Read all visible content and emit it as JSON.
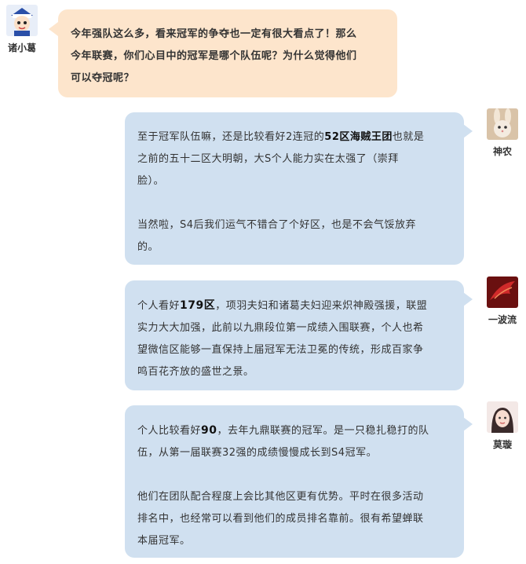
{
  "messages": [
    {
      "sender": "诸小葛",
      "side": "left",
      "paragraphs": [
        [
          "今年强队这么多，看来冠军的争夺也一定有很大看点了！那么"
        ],
        [
          "今年联赛，你们心目中的冠军是哪个队伍呢？为什么觉得他们"
        ],
        [
          "可以夺冠呢？"
        ]
      ]
    },
    {
      "sender": "神农",
      "side": "right",
      "p1_a": "至于冠军队伍嘛，还是比较看好2连冠的",
      "p1_b": "52区海贼王团",
      "p1_c": "也就是",
      "p1_d": "之前的五十二区大明朝，大S个人能力实在太强了（崇拜",
      "p1_e": "脸）。",
      "p2_a": "当然啦，S4后我们运气不错合了个好区，也是不会气馁放弃",
      "p2_b": "的。"
    },
    {
      "sender": "一波流",
      "side": "right",
      "a": "个人看好",
      "b": "179区",
      "c": "，项羽夫妇和诸葛夫妇迎来炽神殿强援，联盟",
      "d": "实力大大加强，此前以九鼎段位第一成绩入围联赛，个人也希",
      "e": "望微信区能够一直保持上届冠军无法卫冕的传统，形成百家争",
      "f": "鸣百花齐放的盛世之景。"
    },
    {
      "sender": "莫璇",
      "side": "right",
      "p1_a": "个人比较看好",
      "p1_b": "90",
      "p1_c": "，去年九鼎联赛的冠军。是一只稳扎稳打的队",
      "p1_d": "伍，从第一届联赛32强的成绩慢慢成长到S4冠军。",
      "p2_a": "他们在团队配合程度上会比其他区更有优势。平时在很多活动",
      "p2_b": "排名中，也经常可以看到他们的成员排名靠前。很有希望蝉联",
      "p2_c": "本届冠军。"
    }
  ],
  "colors": {
    "left_bubble": "#fde5cc",
    "right_bubble": "#d0e0f0",
    "text": "#333333"
  },
  "icons": [
    "avatar-zhuxiaoge",
    "avatar-shennong-bunny",
    "avatar-yiboliu-red-bird",
    "avatar-moxuan-girl"
  ]
}
